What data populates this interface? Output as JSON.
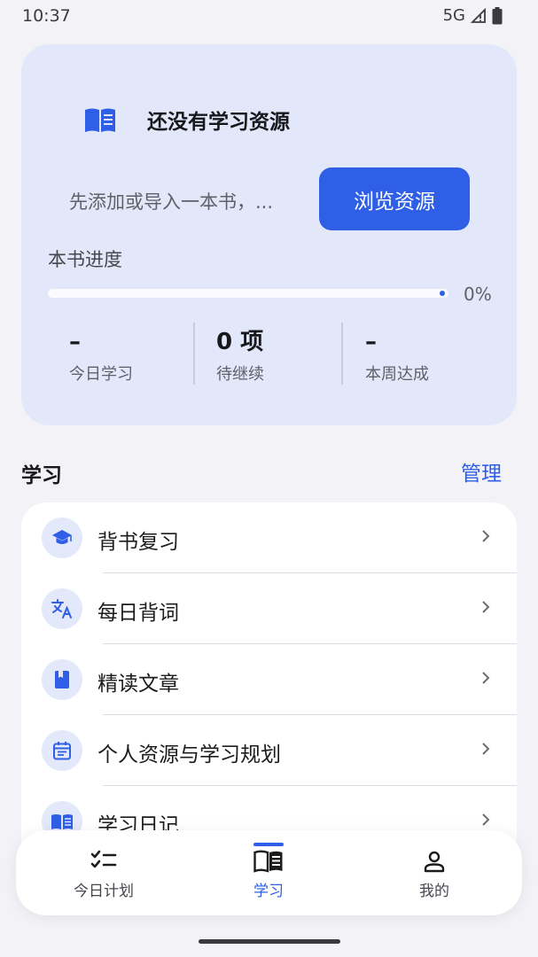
{
  "status_bar": {
    "time": "10:37",
    "network": "5G"
  },
  "hero": {
    "title": "还没有学习资源",
    "description": "先添加或导入一本书，...",
    "browse_button": "浏览资源",
    "progress_label": "本书进度",
    "progress_value": 0,
    "progress_text": "0%",
    "stats": [
      {
        "value": "–",
        "label": "今日学习"
      },
      {
        "value": "0 项",
        "label": "待继续"
      },
      {
        "value": "–",
        "label": "本周达成"
      }
    ]
  },
  "section": {
    "title": "学习",
    "action": "管理"
  },
  "list": {
    "items": [
      {
        "label": "背书复习",
        "icon": "graduation-cap-icon"
      },
      {
        "label": "每日背词",
        "icon": "translate-icon"
      },
      {
        "label": "精读文章",
        "icon": "book-icon"
      },
      {
        "label": "个人资源与学习规划",
        "icon": "calendar-icon"
      },
      {
        "label": "学习日记",
        "icon": "open-book-icon"
      }
    ]
  },
  "bottom_nav": {
    "items": [
      {
        "label": "今日计划",
        "icon": "checklist-icon"
      },
      {
        "label": "学习",
        "icon": "open-book-icon",
        "active": true
      },
      {
        "label": "我的",
        "icon": "person-icon"
      }
    ]
  },
  "colors": {
    "accent": "#2e5fe6",
    "hero_bg": "#e2e8f9",
    "page_bg": "#f3f2f7"
  }
}
